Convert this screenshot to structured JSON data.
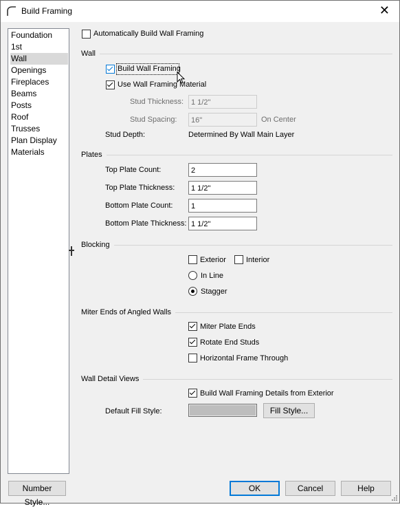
{
  "window": {
    "title": "Build Framing",
    "close_glyph": "✕"
  },
  "sidebar": {
    "items": [
      {
        "label": "Foundation"
      },
      {
        "label": "1st"
      },
      {
        "label": "Wall"
      },
      {
        "label": "Openings"
      },
      {
        "label": "Fireplaces"
      },
      {
        "label": "Beams"
      },
      {
        "label": "Posts"
      },
      {
        "label": "Roof"
      },
      {
        "label": "Trusses"
      },
      {
        "label": "Plan Display"
      },
      {
        "label": "Materials"
      }
    ],
    "selected": "Wall"
  },
  "auto_build": {
    "label": "Automatically Build Wall Framing",
    "checked": false
  },
  "wall": {
    "title": "Wall",
    "build_wall_framing": {
      "label": "Build Wall Framing",
      "checked": true
    },
    "use_material": {
      "label": "Use Wall Framing Material",
      "checked": true
    },
    "stud_thickness": {
      "label": "Stud Thickness:",
      "value": "1 1/2\""
    },
    "stud_spacing": {
      "label": "Stud Spacing:",
      "value": "16\"",
      "suffix": "On Center"
    },
    "stud_depth": {
      "label": "Stud Depth:",
      "value": "Determined By Wall Main Layer"
    }
  },
  "plates": {
    "title": "Plates",
    "top_count": {
      "label": "Top Plate Count:",
      "value": "2"
    },
    "top_thickness": {
      "label": "Top Plate Thickness:",
      "value": "1 1/2\""
    },
    "bottom_count": {
      "label": "Bottom Plate Count:",
      "value": "1"
    },
    "bottom_thickness": {
      "label": "Bottom Plate Thickness:",
      "value": "1 1/2\""
    }
  },
  "blocking": {
    "title": "Blocking",
    "exterior": {
      "label": "Exterior",
      "checked": false
    },
    "interior": {
      "label": "Interior",
      "checked": false
    },
    "in_line": {
      "label": "In Line",
      "selected": false
    },
    "stagger": {
      "label": "Stagger",
      "selected": true
    }
  },
  "miter": {
    "title": "Miter Ends of Angled Walls",
    "miter_plate_ends": {
      "label": "Miter Plate Ends",
      "checked": true
    },
    "rotate_end_studs": {
      "label": "Rotate End Studs",
      "checked": true
    },
    "horizontal_frame": {
      "label": "Horizontal Frame Through",
      "checked": false
    }
  },
  "detail": {
    "title": "Wall Detail Views",
    "build_details": {
      "label": "Build Wall Framing Details from Exterior",
      "checked": true
    },
    "fill_label": "Default Fill Style:",
    "fill_color": "#bdbdbd",
    "fill_button": "Fill Style..."
  },
  "buttons": {
    "number_style": "Number Style...",
    "ok": "OK",
    "cancel": "Cancel",
    "help": "Help"
  },
  "colors": {
    "accent": "#0078d7",
    "selection": "#d9d9d9",
    "panel": "#f0f0f0"
  }
}
